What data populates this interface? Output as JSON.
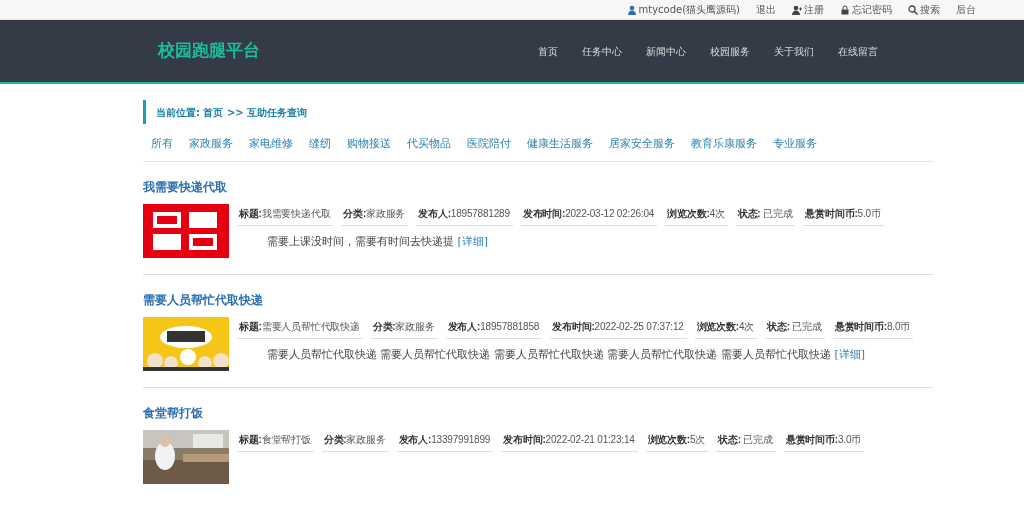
{
  "top_bar": {
    "items": [
      {
        "kind": "user",
        "label": "mtycode(猫头鹰源码)"
      },
      {
        "kind": "plain",
        "label": "退出"
      },
      {
        "kind": "register",
        "label": "注册"
      },
      {
        "kind": "lock",
        "label": "忘记密码"
      },
      {
        "kind": "search",
        "label": "搜索"
      },
      {
        "kind": "plain",
        "label": "后台"
      }
    ]
  },
  "header": {
    "logo": "校园跑腿平台",
    "nav": [
      "首页",
      "任务中心",
      "新闻中心",
      "校园服务",
      "关于我们",
      "在线留言"
    ]
  },
  "breadcrumb": {
    "label": "当前位置:",
    "path": "首页 >> 互助任务查询"
  },
  "categories": [
    "所有",
    "家政服务",
    "家电维修",
    "缝纫",
    "购物接送",
    "代买物品",
    "医院陪付",
    "健康生活服务",
    "居家安全服务",
    "教育乐康服务",
    "专业服务"
  ],
  "tasks": [
    {
      "title": "我需要快递代取",
      "kind": "picture",
      "fields": [
        "**标题:**我需要快递代取",
        "**分类:**家政服务",
        "**发布人:**18957881289",
        "**发布时间:**2022-03-12 02:26:04",
        "**浏览次数:**4次",
        "**状态:** 已完成",
        "**悬赏时间币:**5.0币"
      ],
      "description": "需要上课没时间，需要有时间去快递提",
      "link": "[详细]"
    },
    {
      "title": "需要人员帮忙代取快递",
      "kind": "picture",
      "fields": [
        "**标题:**需要人员帮忙代取快递",
        "**分类:**家政服务",
        "**发布人:**18957881858",
        "**发布时间:**2022-02-25 07:37:12",
        "**浏览次数:**4次",
        "**状态:** 已完成",
        "**悬赏时间币:**8.0币"
      ],
      "description": "需要人员帮忙代取快递 需要人员帮忙代取快递 需要人员帮忙代取快递 需要人员帮忙代取快递 需要人员帮忙代取快递",
      "link": "[详细]"
    },
    {
      "title": "食堂帮打饭",
      "kind": "picture",
      "fields": [
        "**标题:**食堂帮打饭",
        "**分类:**家政服务",
        "**发布人:**13397991899",
        "**发布时间:**2022-02-21 01:23:14",
        "**浏览次数:**5次",
        "**状态:** 已完成",
        "**悬赏时间币:**3.0币"
      ]
    }
  ]
}
